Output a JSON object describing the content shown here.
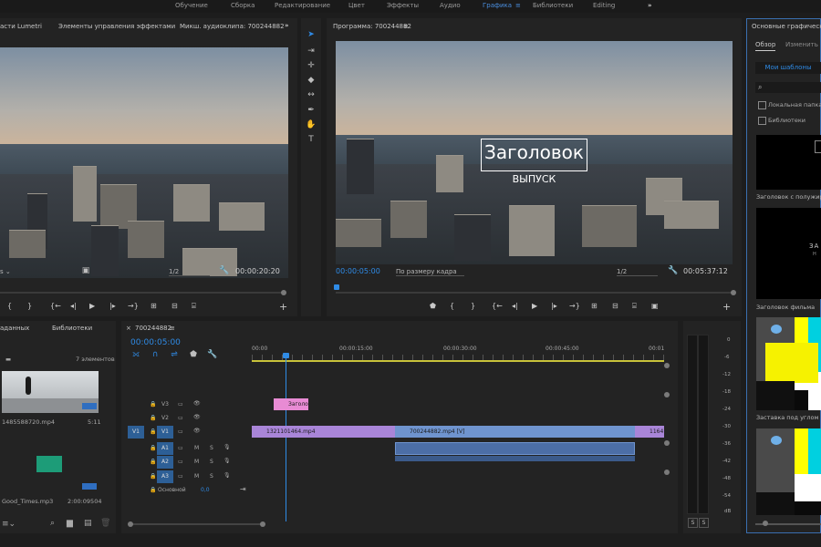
{
  "workspaces": [
    "Обучение",
    "Сборка",
    "Редактирование",
    "Цвет",
    "Эффекты",
    "Аудио",
    "Графика",
    "Библиотеки",
    "Editing"
  ],
  "workspace_active": "Графика",
  "workspace_menu_icon": "≡",
  "more_icon": "»",
  "source_panel": {
    "tabs": [
      "асти Lumetri",
      "Элементы управления эффектами",
      "Микш. аудиоклипа: 700244882"
    ],
    "resolution": "1/2",
    "timecode": "00:00:20:20",
    "controls": [
      "{",
      "}",
      "{←",
      "◂|",
      "▶",
      "|▸",
      "→}",
      "⊞",
      "⊟",
      "⌸"
    ]
  },
  "program_panel": {
    "title": "Программа: 700244882",
    "menu_icon": "≡",
    "title_overlay": "Заголовок",
    "subtitle_overlay": "ВЫПУСК",
    "timecode_current": "00:00:05:00",
    "fit": "По размеру кадра",
    "resolution": "1/2",
    "timecode_duration": "00:05:37:12"
  },
  "project_panel": {
    "tabs": [
      "аданных",
      "Библиотеки"
    ],
    "items_count": "7 элементов",
    "clip1_name": "1485588720.mp4",
    "clip1_duration": "5:11",
    "clip2_name": "Good_Times.mp3",
    "clip2_duration": "2:00:09504"
  },
  "timeline": {
    "tab_label": "700244882",
    "timecode": "00:00:05:00",
    "ruler": [
      "00:00",
      "00:00:15:00",
      "00:00:30:00",
      "00:00:45:00",
      "00:01"
    ],
    "video_tracks": [
      "V3",
      "V2",
      "V1"
    ],
    "audio_tracks": [
      "A1",
      "A2",
      "A3"
    ],
    "source_patch_v": "V1",
    "master_label": "Основной",
    "master_value": "0,0",
    "clips": {
      "title_clip": "Заголо",
      "clip_a": "1321101464.mp4",
      "clip_b": "700244882.mp4 [V]",
      "clip_c": "1164"
    },
    "track_flags": [
      "M",
      "S"
    ]
  },
  "audio_meter": {
    "scale": [
      "0",
      "-6",
      "-12",
      "-18",
      "-24",
      "-30",
      "-36",
      "-42",
      "-48",
      "-54",
      "dB"
    ],
    "solo_buttons": [
      "S",
      "S"
    ]
  },
  "essential_graphics": {
    "title": "Основные графические",
    "tabs": [
      "Обзор",
      "Изменить"
    ],
    "my_templates": "Мои шаблоны",
    "local_folder": "Локальная папка ш",
    "libraries": "Библиотеки",
    "templates": [
      {
        "caption": "Заголовок с полужир"
      },
      {
        "caption": "Заголовок фильма"
      },
      {
        "caption": "Заставка под углом"
      },
      {
        "caption": ""
      }
    ],
    "film_title_thumb_text": "ЗА",
    "film_title_thumb_sub": "Н"
  },
  "colors": {
    "accent": "#2f8be6",
    "video_clip": "#a985d8",
    "video_clip_blue": "#6f94cf",
    "title_clip": "#e88bd4",
    "audio_clip": "#4c6ea6"
  }
}
